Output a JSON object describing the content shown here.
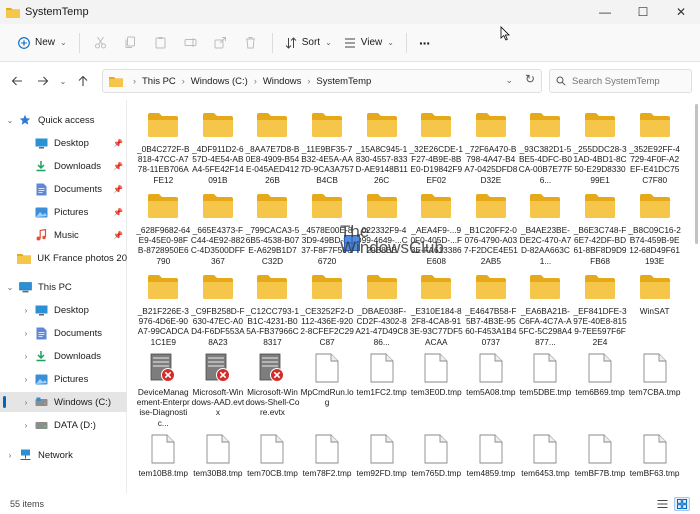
{
  "window": {
    "title": "SystemTemp",
    "minimize": "—",
    "maximize": "☐",
    "close": "✕"
  },
  "toolbar": {
    "new_label": "New",
    "sort_label": "Sort",
    "view_label": "View",
    "more_label": "···"
  },
  "address": {
    "crumbs": [
      "This PC",
      "Windows (C:)",
      "Windows",
      "SystemTemp"
    ]
  },
  "search": {
    "placeholder": "Search SystemTemp"
  },
  "sidebar": {
    "items": [
      {
        "label": "Quick access",
        "icon": "star-icon"
      },
      {
        "label": "Desktop",
        "icon": "desktop-icon"
      },
      {
        "label": "Downloads",
        "icon": "download-icon"
      },
      {
        "label": "Documents",
        "icon": "documents-icon"
      },
      {
        "label": "Pictures",
        "icon": "pictures-icon"
      },
      {
        "label": "Music",
        "icon": "music-icon"
      },
      {
        "label": "UK France photos 20",
        "icon": "folder-icon"
      },
      {
        "label": "This PC",
        "icon": "pc-icon"
      },
      {
        "label": "Desktop",
        "icon": "desktop-icon"
      },
      {
        "label": "Documents",
        "icon": "documents-icon"
      },
      {
        "label": "Downloads",
        "icon": "download-icon"
      },
      {
        "label": "Pictures",
        "icon": "pictures-icon"
      },
      {
        "label": "Windows (C:)",
        "icon": "drive-icon"
      },
      {
        "label": "DATA (D:)",
        "icon": "drive-icon"
      },
      {
        "label": "Network",
        "icon": "network-icon"
      }
    ]
  },
  "files": [
    {
      "name": "_0B4C272F-B818-47CC-A778-11EB706AFE12",
      "type": "folder"
    },
    {
      "name": "_4DF911D2-657D-4E54-ABA4-5FE42F14091B",
      "type": "folder"
    },
    {
      "name": "_8AA7E7D8-B0E8-4909-B54E-045AED41226B",
      "type": "folder"
    },
    {
      "name": "_11E9BF35-7B32-4E5A-AA7D-9CA3A757B4CB",
      "type": "folder"
    },
    {
      "name": "_15A8C945-1830-4557-833D-AE9148B1126C",
      "type": "folder"
    },
    {
      "name": "_32E26CDE-1F27-4B9E-8BE0-D19842F9EF02",
      "type": "folder"
    },
    {
      "name": "_72F6A470-B798-4A47-B4A7-0425DFD8D32E",
      "type": "folder"
    },
    {
      "name": "_93C382D1-5BE5-4DFC-B0CA-00B7E77F6...",
      "type": "folder"
    },
    {
      "name": "_255DDC28-31AD-4BD1-8C50-E29D833099E1",
      "type": "folder"
    },
    {
      "name": "_352E92FF-4729-4F0F-A2EF-E41DC75C7F80",
      "type": "folder"
    },
    {
      "name": "_628F9682-64E9-45E0-98FB-8728950E6790",
      "type": "folder"
    },
    {
      "name": "_665E4373-FC44-4E92-882C-4D3500DFF367",
      "type": "folder"
    },
    {
      "name": "_799CACA3-56B5-4538-B07E-A629B1D7C32D",
      "type": "folder"
    },
    {
      "name": "_4578E00E-83D9-49BD-8537-F8F7F56C6720",
      "type": "folder"
    },
    {
      "name": "_022332F9-4D99-4649-...C29B8BB",
      "type": "folder"
    },
    {
      "name": "_AEA4F9-...90F0-405D-...F3E-FA613386E608",
      "type": "folder"
    },
    {
      "name": "_B1C20FF2-0076-4790-A037-F2DCE4E512AB5",
      "type": "folder"
    },
    {
      "name": "_B4AE23BE-DE2C-470-A7D-82AA663C1...",
      "type": "folder"
    },
    {
      "name": "_B6E3C748-F6E7-42DF-BD61-8BF8D9D9FB68",
      "type": "folder"
    },
    {
      "name": "_B8C09C16-2B74-459B-9E12-68D49F61193E",
      "type": "folder"
    },
    {
      "name": "_B21F226E-3976-4D6E-90A7-99CADCA1C1E9",
      "type": "folder"
    },
    {
      "name": "_C9FB258D-F630-47EC-A0D4-F6DF553A8A23",
      "type": "folder"
    },
    {
      "name": "_C12CC793-1B1C-4231-B05A-FB37966C8317",
      "type": "folder"
    },
    {
      "name": "_CE3252F2-D112-436E-9202-8CFEF2C29C87",
      "type": "folder"
    },
    {
      "name": "_DBAE038F-CD2F-4302-8A21-47D49C886...",
      "type": "folder"
    },
    {
      "name": "_E310E184-82F8-4CA8-913E-93C77DF5ACAA",
      "type": "folder"
    },
    {
      "name": "_E4647B58-F5B7-4B3E-9560-F453A1B40737",
      "type": "folder"
    },
    {
      "name": "_EA6BA21B-C6FA-4C7A-A5FC-5C298A4877...",
      "type": "folder"
    },
    {
      "name": "_EF841DFE-397E-40E8-8159-7EE597F6F2E4",
      "type": "folder"
    },
    {
      "name": "WinSAT",
      "type": "folder"
    },
    {
      "name": "DeviceManagement-Enterprise-Diagnostic...",
      "type": "evtx"
    },
    {
      "name": "Microsoft-Windows-AAD.evtx",
      "type": "evtx"
    },
    {
      "name": "Microsoft-Windows-Shell-Core.evtx",
      "type": "evtx"
    },
    {
      "name": "MpCmdRun.log",
      "type": "file"
    },
    {
      "name": "tem1FC2.tmp",
      "type": "file"
    },
    {
      "name": "tem3E0D.tmp",
      "type": "file"
    },
    {
      "name": "tem5A08.tmp",
      "type": "file"
    },
    {
      "name": "tem5DBE.tmp",
      "type": "file"
    },
    {
      "name": "tem6B69.tmp",
      "type": "file"
    },
    {
      "name": "tem7CBA.tmp",
      "type": "file"
    },
    {
      "name": "tem10B8.tmp",
      "type": "file"
    },
    {
      "name": "tem30B8.tmp",
      "type": "file"
    },
    {
      "name": "tem70CB.tmp",
      "type": "file"
    },
    {
      "name": "tem78F2.tmp",
      "type": "file"
    },
    {
      "name": "tem92FD.tmp",
      "type": "file"
    },
    {
      "name": "tem765D.tmp",
      "type": "file"
    },
    {
      "name": "tem4859.tmp",
      "type": "file"
    },
    {
      "name": "tem6453.tmp",
      "type": "file"
    },
    {
      "name": "temBF7B.tmp",
      "type": "file"
    },
    {
      "name": "temBF63.tmp",
      "type": "file"
    }
  ],
  "status": {
    "count": "55 items"
  },
  "watermark": {
    "line1": "The",
    "line2": "WindowsClub"
  },
  "colors": {
    "folder": "#f6c64a",
    "folder_dark": "#e6a919",
    "accent": "#0067c0",
    "selection": "#e5e5e5"
  }
}
